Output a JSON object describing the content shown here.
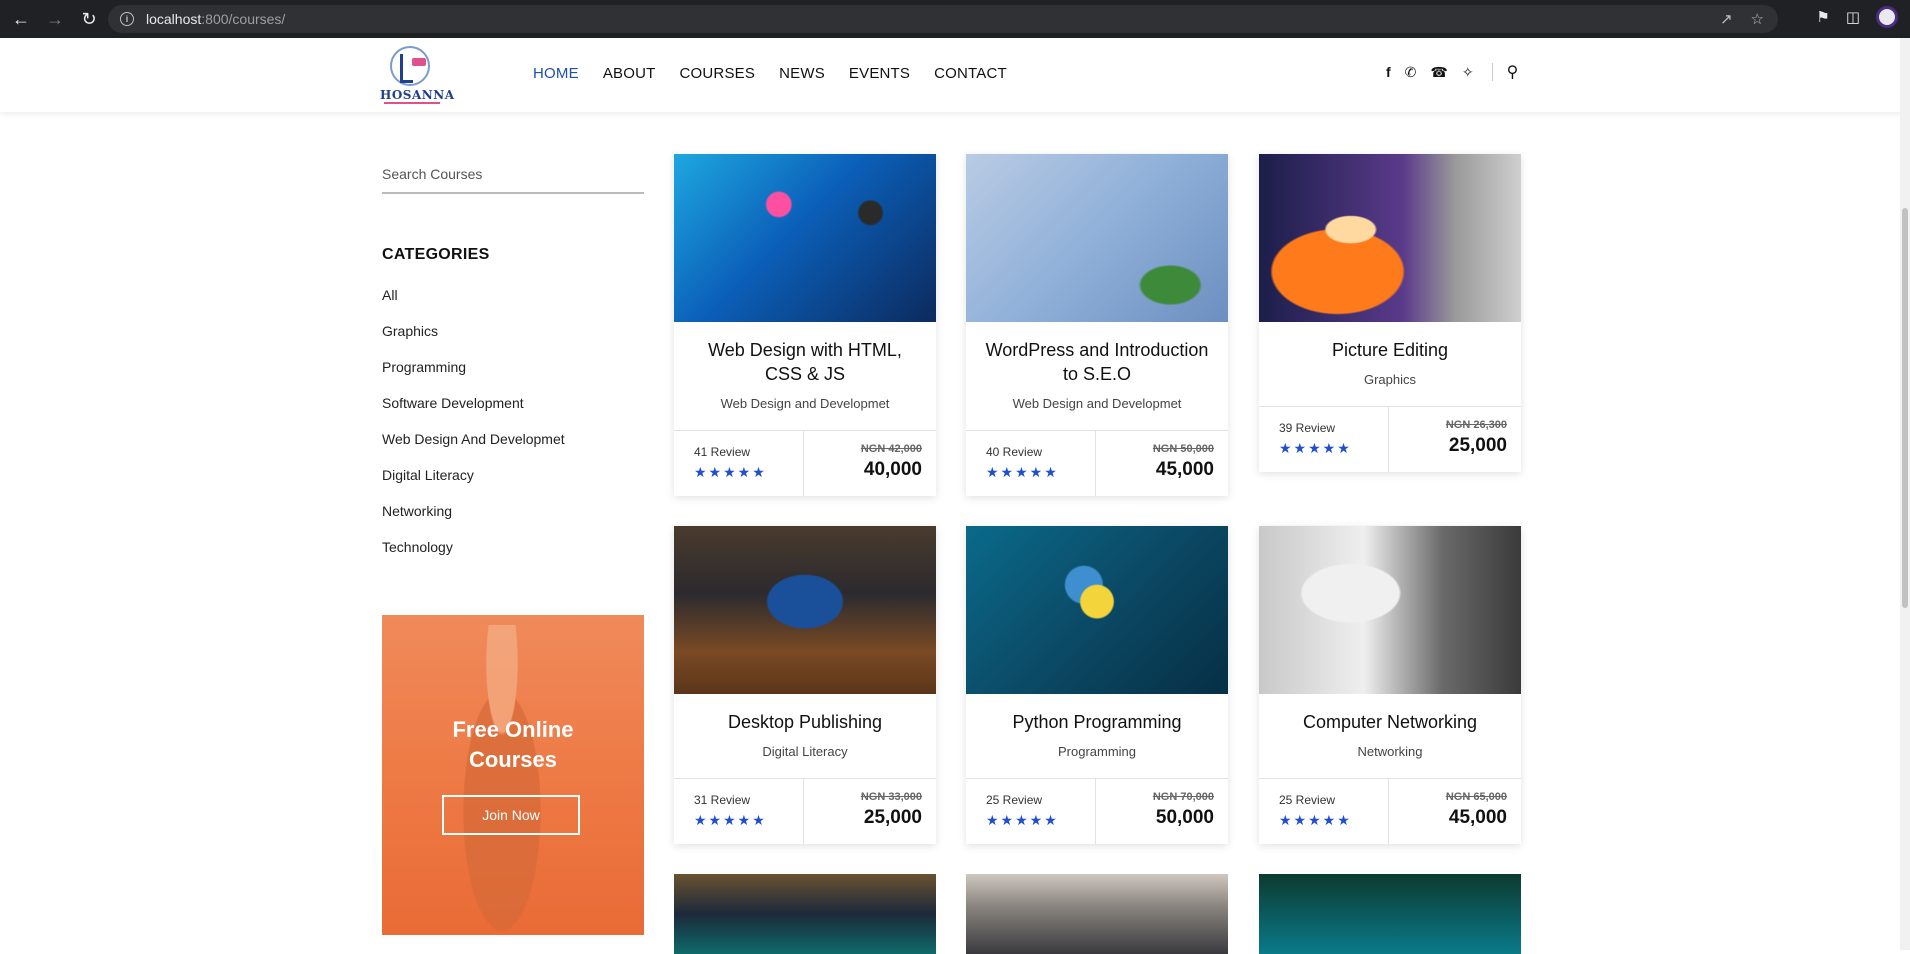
{
  "browser": {
    "url_host": "localhost",
    "url_path": ":800/courses/"
  },
  "header": {
    "logo_text": "HOSANNA",
    "nav": [
      {
        "label": "HOME",
        "active": true
      },
      {
        "label": "ABOUT",
        "active": false
      },
      {
        "label": "COURSES",
        "active": false
      },
      {
        "label": "NEWS",
        "active": false
      },
      {
        "label": "EVENTS",
        "active": false
      },
      {
        "label": "CONTACT",
        "active": false
      }
    ],
    "social_icons": [
      "facebook-icon",
      "whatsapp-icon",
      "phone-icon",
      "twitter-icon"
    ],
    "search_icon": "search-icon"
  },
  "sidebar": {
    "search_placeholder": "Search Courses",
    "categories_title": "CATEGORIES",
    "categories": [
      "All",
      "Graphics",
      "Programming",
      "Software Development",
      "Web Design And Developmet",
      "Digital Literacy",
      "Networking",
      "Technology"
    ],
    "promo": {
      "title_line1": "Free Online",
      "title_line2": "Courses",
      "button": "Join Now"
    }
  },
  "courses": [
    {
      "title": "Web Design with HTML, CSS & JS",
      "category": "Web Design and Developmet",
      "reviews": "41 Review",
      "rating": 5,
      "old_price": "NGN 42,000",
      "price": "40,000"
    },
    {
      "title": "WordPress and Introduction to S.E.O",
      "category": "Web Design and Developmet",
      "reviews": "40 Review",
      "rating": 5,
      "old_price": "NGN 50,000",
      "price": "45,000"
    },
    {
      "title": "Picture Editing",
      "category": "Graphics",
      "reviews": "39 Review",
      "rating": 5,
      "old_price": "NGN 26,300",
      "price": "25,000"
    },
    {
      "title": "Desktop Publishing",
      "category": "Digital Literacy",
      "reviews": "31 Review",
      "rating": 5,
      "old_price": "NGN 33,000",
      "price": "25,000"
    },
    {
      "title": "Python Programming",
      "category": "Programming",
      "reviews": "25 Review",
      "rating": 5,
      "old_price": "NGN 70,000",
      "price": "50,000"
    },
    {
      "title": "Computer Networking",
      "category": "Networking",
      "reviews": "25 Review",
      "rating": 5,
      "old_price": "NGN 65,000",
      "price": "45,000"
    }
  ],
  "colors": {
    "accent": "#1f4fa8",
    "star": "#1f4fd0",
    "promo": "#ee7a45"
  }
}
